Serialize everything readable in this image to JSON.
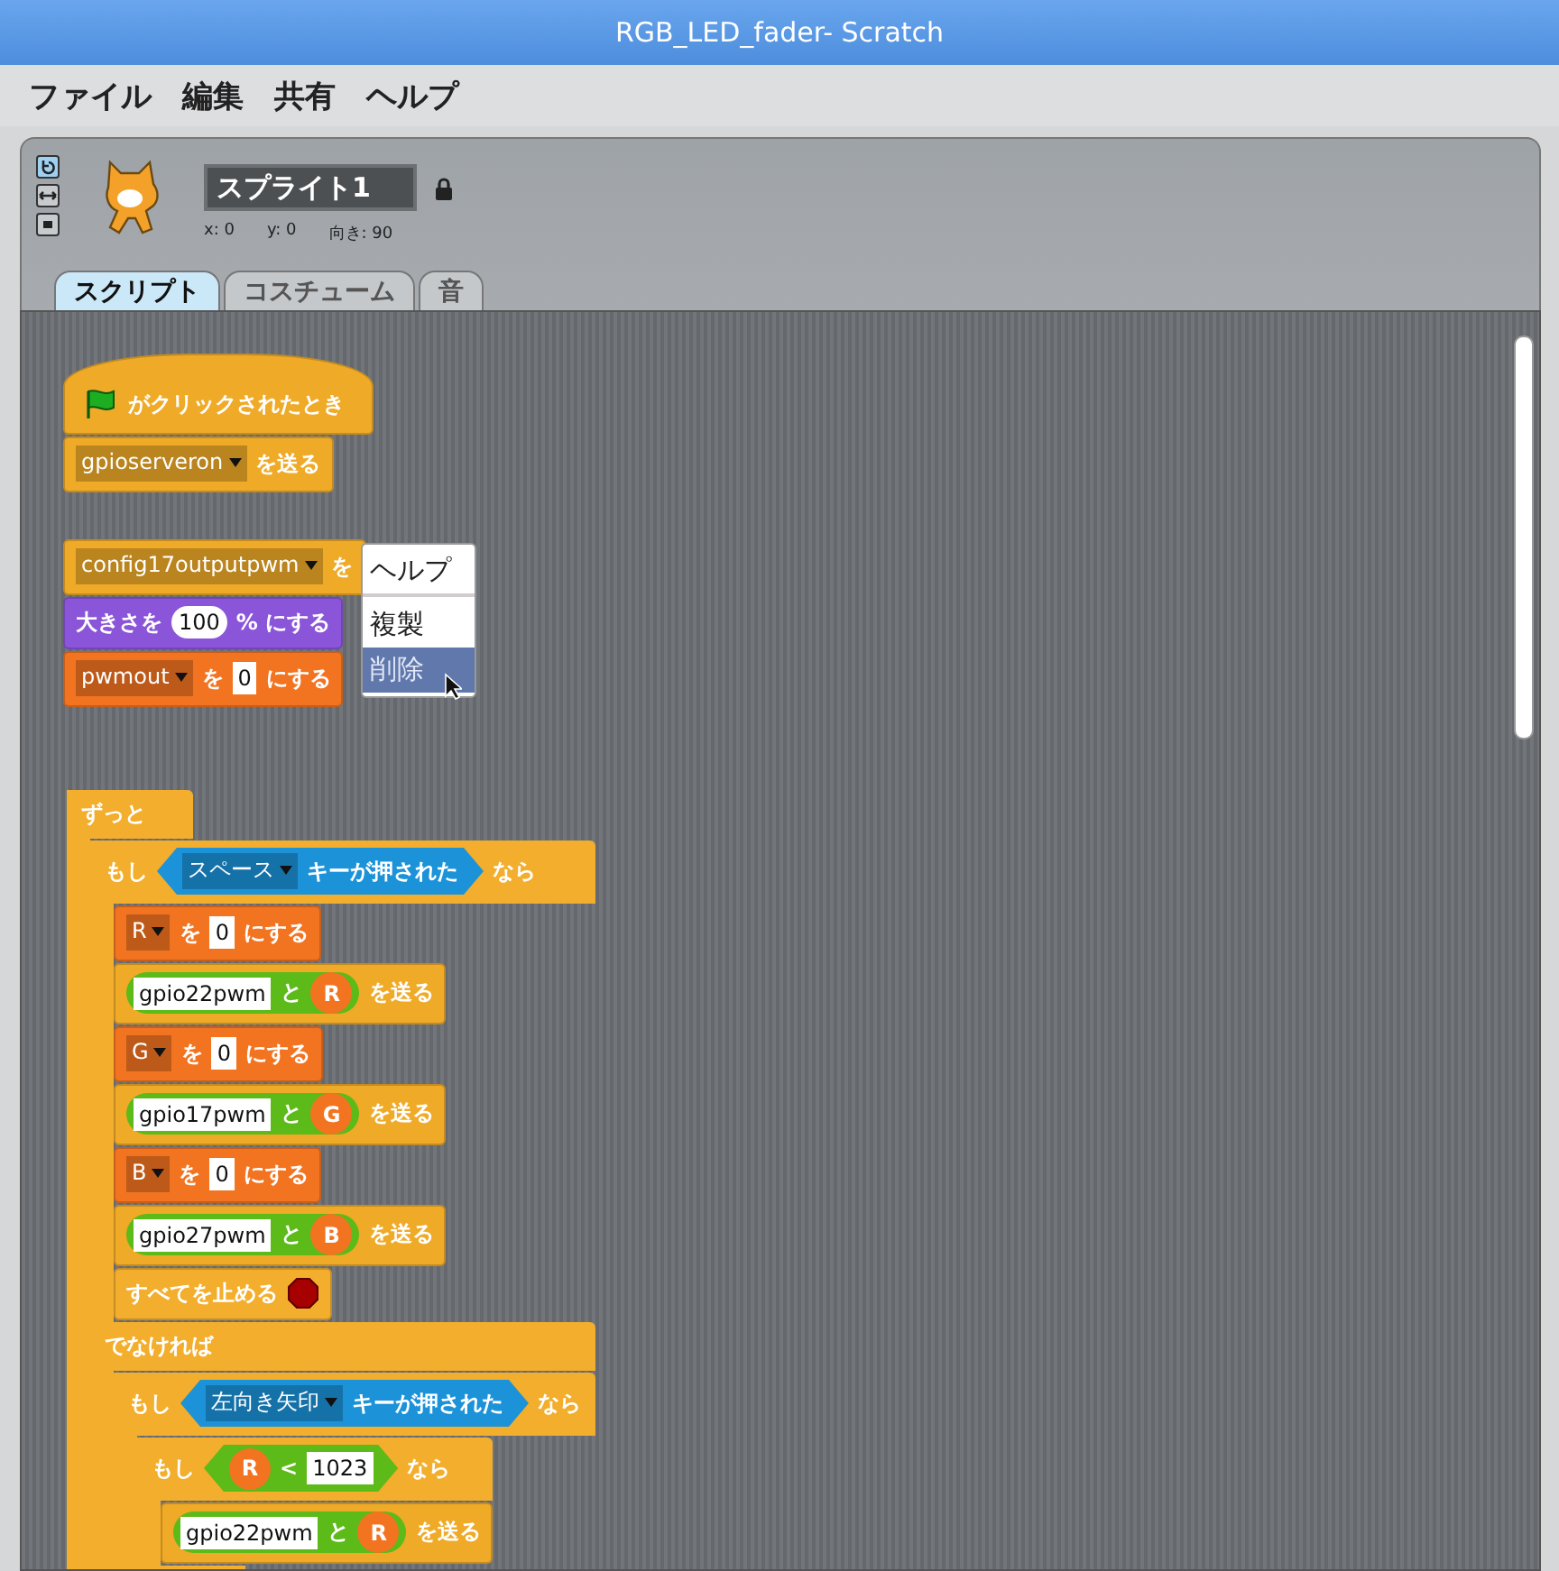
{
  "window": {
    "title": "RGB_LED_fader- Scratch"
  },
  "menu": [
    "ファイル",
    "編集",
    "共有",
    "ヘルプ"
  ],
  "sprite": {
    "rotation_styles": [
      {
        "kind": "rotate",
        "selected": true
      },
      {
        "kind": "flip",
        "selected": false
      },
      {
        "kind": "none",
        "selected": false
      }
    ],
    "name": "スプライト1",
    "x": "x: 0",
    "y": "y: 0",
    "direction": "向き: 90"
  },
  "tabs": [
    {
      "label": "スクリプト",
      "selected": true
    },
    {
      "label": "コスチューム",
      "selected": false
    },
    {
      "label": "音",
      "selected": false
    }
  ],
  "scripts": [
    {
      "blocks": [
        {
          "kind": "hat",
          "parts": [
            {
              "kind": "flag"
            },
            {
              "kind": "label",
              "text": "がクリックされたとき"
            }
          ]
        },
        {
          "kind": "broadcast",
          "parts": [
            {
              "kind": "dropdown",
              "text": "gpioserveron"
            },
            {
              "kind": "label",
              "text": "を送る"
            }
          ]
        }
      ]
    },
    {
      "blocks": [
        {
          "kind": "broadcast",
          "parts": [
            {
              "kind": "dropdown",
              "text": "config17outputpwm"
            },
            {
              "kind": "label",
              "text": "を"
            }
          ]
        },
        {
          "kind": "set_size",
          "parts": [
            {
              "kind": "label",
              "text": "大きさを"
            },
            {
              "kind": "number",
              "text": "100"
            },
            {
              "kind": "label",
              "text": "% にする"
            }
          ]
        },
        {
          "kind": "set_variable",
          "parts": [
            {
              "kind": "dropdown",
              "text": "pwmout"
            },
            {
              "kind": "label",
              "text": "を"
            },
            {
              "kind": "text",
              "text": "0"
            },
            {
              "kind": "label",
              "text": "にする"
            }
          ]
        }
      ]
    },
    {
      "blocks": [
        {
          "kind": "forever",
          "parts": [
            {
              "kind": "label",
              "text": "ずっと"
            }
          ],
          "children": [
            {
              "kind": "if_else",
              "parts": [
                {
                  "kind": "label",
                  "text": "もし"
                },
                {
                  "kind": "key_pressed",
                  "parts": [
                    {
                      "kind": "dropdown",
                      "text": "スペース"
                    },
                    {
                      "kind": "label",
                      "text": "キーが押された"
                    }
                  ]
                },
                {
                  "kind": "label",
                  "text": "なら"
                }
              ],
              "children": [
                {
                  "kind": "set_variable",
                  "parts": [
                    {
                      "kind": "dropdown",
                      "text": "R"
                    },
                    {
                      "kind": "label",
                      "text": "を"
                    },
                    {
                      "kind": "text",
                      "text": "0"
                    },
                    {
                      "kind": "label",
                      "text": "にする"
                    }
                  ]
                },
                {
                  "kind": "broadcast",
                  "parts": [
                    {
                      "kind": "join",
                      "parts": [
                        {
                          "kind": "text",
                          "text": "gpio22pwm"
                        },
                        {
                          "kind": "label",
                          "text": "と"
                        },
                        {
                          "kind": "variable",
                          "parts": [
                            {
                              "kind": "label",
                              "text": "R"
                            }
                          ]
                        }
                      ]
                    },
                    {
                      "kind": "label",
                      "text": "を送る"
                    }
                  ]
                },
                {
                  "kind": "set_variable",
                  "parts": [
                    {
                      "kind": "dropdown",
                      "text": "G"
                    },
                    {
                      "kind": "label",
                      "text": "を"
                    },
                    {
                      "kind": "text",
                      "text": "0"
                    },
                    {
                      "kind": "label",
                      "text": "にする"
                    }
                  ]
                },
                {
                  "kind": "broadcast",
                  "parts": [
                    {
                      "kind": "join",
                      "parts": [
                        {
                          "kind": "text",
                          "text": "gpio17pwm"
                        },
                        {
                          "kind": "label",
                          "text": "と"
                        },
                        {
                          "kind": "variable",
                          "parts": [
                            {
                              "kind": "label",
                              "text": "G"
                            }
                          ]
                        }
                      ]
                    },
                    {
                      "kind": "label",
                      "text": "を送る"
                    }
                  ]
                },
                {
                  "kind": "set_variable",
                  "parts": [
                    {
                      "kind": "dropdown",
                      "text": "B"
                    },
                    {
                      "kind": "label",
                      "text": "を"
                    },
                    {
                      "kind": "text",
                      "text": "0"
                    },
                    {
                      "kind": "label",
                      "text": "にする"
                    }
                  ]
                },
                {
                  "kind": "broadcast",
                  "parts": [
                    {
                      "kind": "join",
                      "parts": [
                        {
                          "kind": "text",
                          "text": "gpio27pwm"
                        },
                        {
                          "kind": "label",
                          "text": "と"
                        },
                        {
                          "kind": "variable",
                          "parts": [
                            {
                              "kind": "label",
                              "text": "B"
                            }
                          ]
                        }
                      ]
                    },
                    {
                      "kind": "label",
                      "text": "を送る"
                    }
                  ]
                },
                {
                  "kind": "stop_all",
                  "parts": [
                    {
                      "kind": "label",
                      "text": "すべてを止める"
                    },
                    {
                      "kind": "stop"
                    }
                  ]
                }
              ],
              "else_parts": [
                {
                  "kind": "label",
                  "text": "でなければ"
                }
              ],
              "else_children": [
                {
                  "kind": "if",
                  "parts": [
                    {
                      "kind": "label",
                      "text": "もし"
                    },
                    {
                      "kind": "key_pressed",
                      "parts": [
                        {
                          "kind": "dropdown",
                          "text": "左向き矢印"
                        },
                        {
                          "kind": "label",
                          "text": "キーが押された"
                        }
                      ]
                    },
                    {
                      "kind": "label",
                      "text": "なら"
                    }
                  ],
                  "children": [
                    {
                      "kind": "if",
                      "parts": [
                        {
                          "kind": "label",
                          "text": "もし"
                        },
                        {
                          "kind": "less_than",
                          "parts": [
                            {
                              "kind": "variable",
                              "parts": [
                                {
                                  "kind": "label",
                                  "text": "R"
                                }
                              ]
                            },
                            {
                              "kind": "label",
                              "text": "<"
                            },
                            {
                              "kind": "text",
                              "text": "1023"
                            }
                          ]
                        },
                        {
                          "kind": "label",
                          "text": "なら"
                        }
                      ],
                      "children": [
                        {
                          "kind": "broadcast",
                          "parts": [
                            {
                              "kind": "join",
                              "parts": [
                                {
                                  "kind": "text",
                                  "text": "gpio22pwm"
                                },
                                {
                                  "kind": "label",
                                  "text": "と"
                                },
                                {
                                  "kind": "variable",
                                  "parts": [
                                    {
                                      "kind": "label",
                                      "text": "R"
                                    }
                                  ]
                                }
                              ]
                            },
                            {
                              "kind": "label",
                              "text": "を送る"
                            }
                          ]
                        }
                      ]
                    }
                  ]
                }
              ]
            }
          ]
        }
      ]
    }
  ],
  "context_menu": [
    {
      "label": "ヘルプ",
      "selected": false
    },
    {
      "label": "複製",
      "selected": false
    },
    {
      "label": "削除",
      "selected": true
    }
  ]
}
